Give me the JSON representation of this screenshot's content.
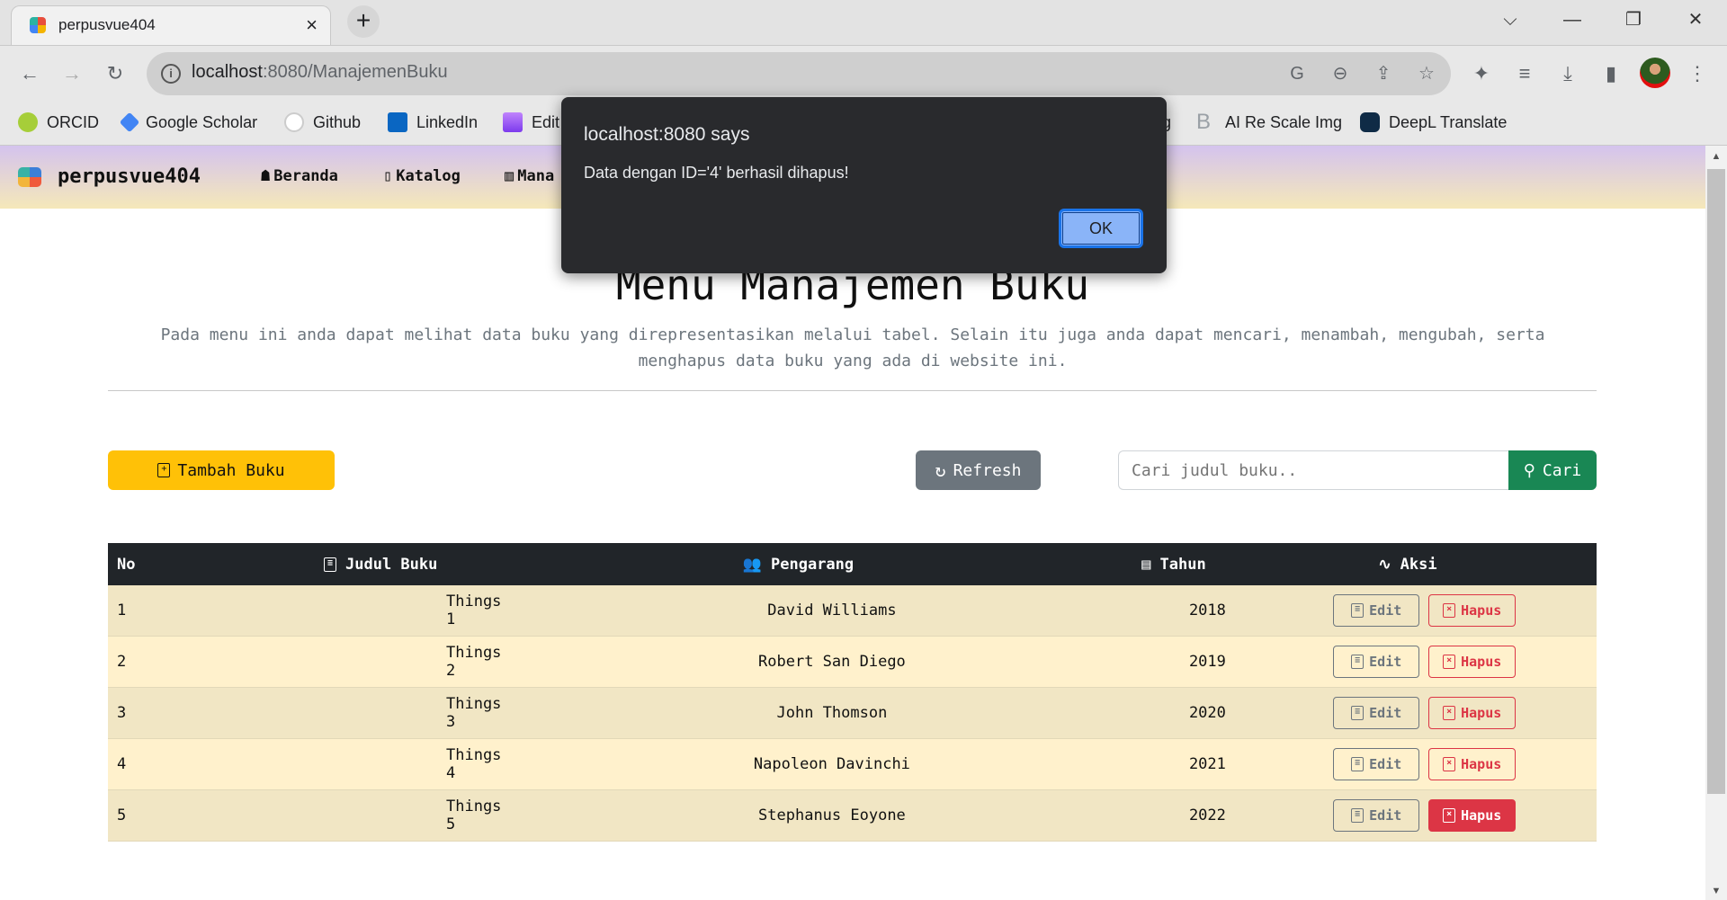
{
  "browser": {
    "tab_title": "perpusvue404",
    "tab_close": "×",
    "new_tab": "+",
    "url_host": "localhost",
    "url_rest": ":8080/ManajemenBuku",
    "window_controls": {
      "tab_search": "⌵",
      "minimize": "—",
      "restore": "❐",
      "close": "✕"
    },
    "toolbar_icons": {
      "back": "←",
      "forward": "→",
      "reload": "↻",
      "info": "i",
      "translate": "G",
      "zoom_out": "⊖",
      "share": "⇪",
      "bookmark_star": "☆",
      "extensions": "✦",
      "media": "≡",
      "download": "⤓",
      "side_panel": "▮",
      "menu": "⋮"
    },
    "bookmarks": [
      {
        "label": "ORCID",
        "icon": "orcid-icon",
        "color": "#a6ce39"
      },
      {
        "label": "Google Scholar",
        "icon": "google-scholar-icon",
        "color": "#4285f4"
      },
      {
        "label": "Github",
        "icon": "github-icon",
        "color": "#ffffff"
      },
      {
        "label": "LinkedIn",
        "icon": "linkedin-icon",
        "color": "#0a66c2"
      },
      {
        "label": "Edit",
        "icon": "edit-bookmark-icon",
        "color": "#8b5cf6"
      },
      {
        "label": "g",
        "icon": "",
        "color": ""
      },
      {
        "label": "AI Re Scale Img",
        "icon": "ai-rescale-icon",
        "color": "#9aa0a6"
      },
      {
        "label": "DeepL Translate",
        "icon": "deepl-icon",
        "color": "#0f2b46"
      }
    ]
  },
  "navbar": {
    "brand": "perpusvue404",
    "links": [
      {
        "label": "Beranda",
        "icon": "☗"
      },
      {
        "label": "Katalog",
        "icon": "▯"
      },
      {
        "label": "Mana",
        "icon": "▥"
      }
    ]
  },
  "page": {
    "heading": "Menu Manajemen Buku",
    "description": "Pada menu ini anda dapat melihat data buku yang direpresentasikan melalui tabel. Selain itu juga anda dapat mencari, menambah, mengubah, serta menghapus data buku yang ada di website ini.",
    "add_button": "Tambah Buku",
    "refresh_button": "Refresh",
    "search_placeholder": "Cari judul buku..",
    "search_value": "",
    "search_button": "Cari"
  },
  "table": {
    "headers": {
      "no": "No",
      "judul": "Judul Buku",
      "pengarang": "Pengarang",
      "tahun": "Tahun",
      "aksi": "Aksi"
    },
    "edit_label": "Edit",
    "delete_label": "Hapus",
    "rows": [
      {
        "no": "1",
        "judul": "Things 1",
        "pengarang": "David Williams",
        "tahun": "2018"
      },
      {
        "no": "2",
        "judul": "Things 2",
        "pengarang": "Robert San Diego",
        "tahun": "2019"
      },
      {
        "no": "3",
        "judul": "Things 3",
        "pengarang": "John Thomson",
        "tahun": "2020"
      },
      {
        "no": "4",
        "judul": "Things 4",
        "pengarang": "Napoleon Davinchi",
        "tahun": "2021"
      },
      {
        "no": "5",
        "judul": "Things 5",
        "pengarang": "Stephanus Eoyone",
        "tahun": "2022"
      }
    ]
  },
  "dialog": {
    "title": "localhost:8080 says",
    "message": "Data dengan ID='4' berhasil dihapus!",
    "ok_label": "OK"
  },
  "colors": {
    "warning": "#ffc107",
    "secondary": "#6c757d",
    "success": "#198754",
    "danger": "#dc3545",
    "table_header": "#212529"
  }
}
